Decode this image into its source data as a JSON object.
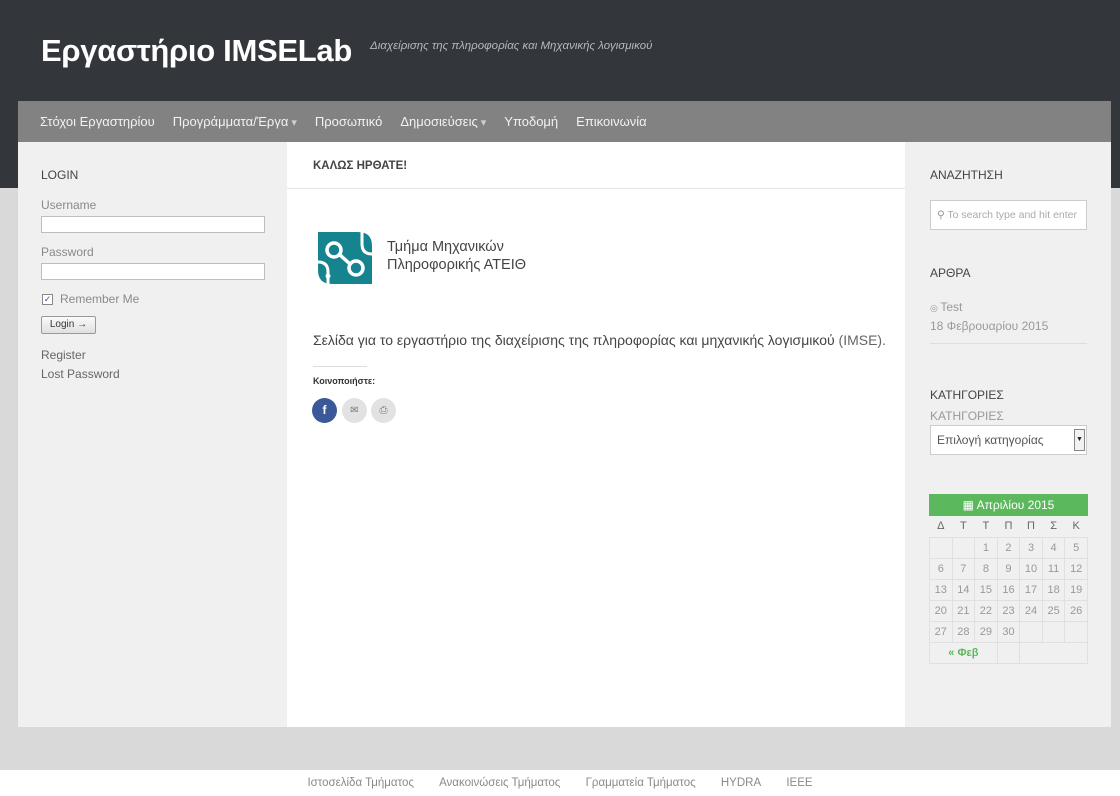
{
  "header": {
    "title": "Εργαστήριο IMSELab",
    "description": "Διαχείρισης της πληροφορίας και Μηχανικής λογισμικού"
  },
  "nav": {
    "items": [
      {
        "label": "Στόχοι Εργαστηρίου"
      },
      {
        "label": "Προγράμματα/Έργα"
      },
      {
        "label": "Προσωπικό"
      },
      {
        "label": "Δημοσιεύσεις"
      },
      {
        "label": "Υποδομή"
      },
      {
        "label": "Επικοινωνία"
      }
    ],
    "caret": "▾"
  },
  "login": {
    "title": "LOGIN",
    "username_label": "Username",
    "username_value": "",
    "password_label": "Password",
    "password_value": "",
    "remember_label": "Remember Me",
    "remember_checked": true,
    "login_button": "Login →",
    "register": "Register",
    "lost_password": "Lost Password"
  },
  "main": {
    "title": "ΚΑΛΩΣ ΗΡΘΑΤΕ!",
    "dept_line1": "Τμήμα Μηχανικών",
    "dept_line2": "Πληροφορικής ΑΤΕΙΘ",
    "intro": "Σελίδα για το εργαστήριο της διαχείρισης της πληροφορίας και μηχανικής λογισμικού",
    "intro_abbr": " (IMSE).",
    "share_label": "Κοινοποιήστε:",
    "share_icons": [
      "facebook-icon",
      "email-icon",
      "print-icon"
    ],
    "brand_color": "#16848f"
  },
  "search": {
    "title": "ΑΝΑΖΗΤΗΣΗ",
    "placeholder": "To search type and hit enter"
  },
  "articles": {
    "title": "ΑΡΘΡΑ",
    "item": "Test",
    "date": "18 Φεβρουαρίου 2015"
  },
  "categories": {
    "title": "ΚΑΤΗΓΟΡΙΕΣ",
    "sub_label": "ΚΑΤΗΓΟΡΙΕΣ",
    "selected": "Επιλογή κατηγορίας"
  },
  "calendar": {
    "month": "Απριλίου 2015",
    "accent": "#5cb85c",
    "days": [
      "Δ",
      "Τ",
      "Τ",
      "Π",
      "Π",
      "Σ",
      "Κ"
    ],
    "weeks": [
      [
        "",
        "",
        "1",
        "2",
        "3",
        "4",
        "5"
      ],
      [
        "6",
        "7",
        "8",
        "9",
        "10",
        "11",
        "12"
      ],
      [
        "13",
        "14",
        "15",
        "16",
        "17",
        "18",
        "19"
      ],
      [
        "20",
        "21",
        "22",
        "23",
        "24",
        "25",
        "26"
      ],
      [
        "27",
        "28",
        "29",
        "30",
        "",
        "",
        ""
      ]
    ],
    "prev": "« Φεβ"
  },
  "footer": {
    "links": [
      "Ιστοσελίδα Τμήματος",
      "Ανακοινώσεις Τμήματος",
      "Γραμματεία Τμήματος",
      "HYDRA",
      "IEEE"
    ]
  }
}
